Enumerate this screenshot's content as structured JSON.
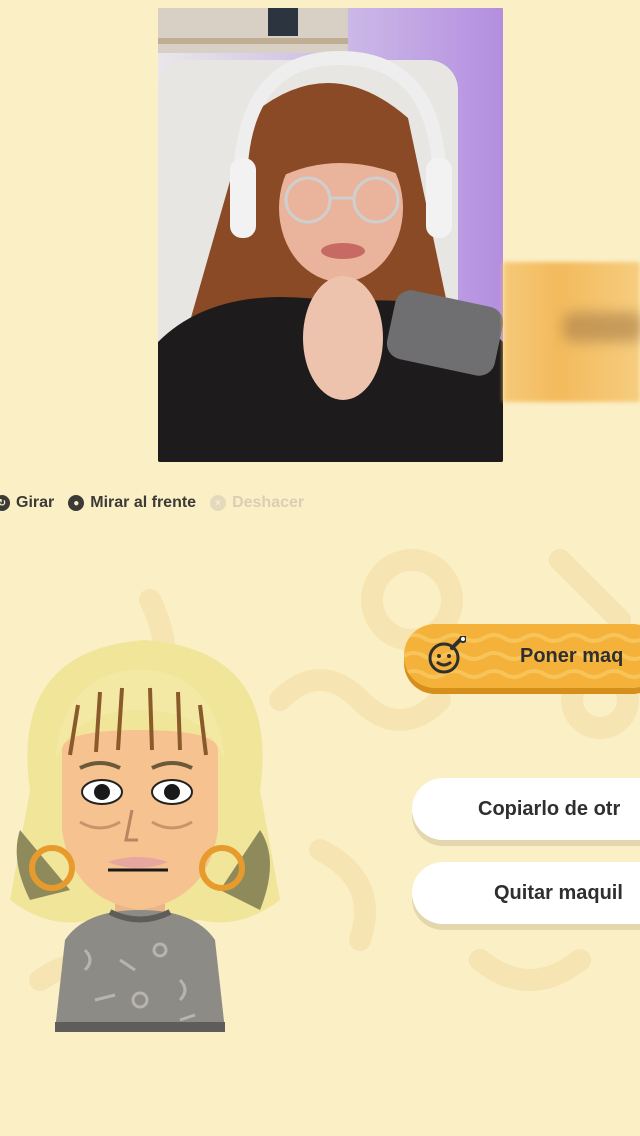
{
  "controls": {
    "rotate_label": "Girar",
    "face_front_label": "Mirar al frente",
    "undo_label": "Deshacer"
  },
  "menu": {
    "apply_makeup_label": "Poner maq",
    "copy_from_other_label": "Copiarlo de otr",
    "remove_makeup_label": "Quitar maquil"
  },
  "colors": {
    "background": "#fbefc6",
    "accent": "#f4b23a",
    "button": "#ffffff"
  },
  "icons": {
    "rotate": "rotate-icon",
    "face_front": "face-front-icon",
    "undo": "undo-icon",
    "makeup": "makeup-face-icon"
  }
}
